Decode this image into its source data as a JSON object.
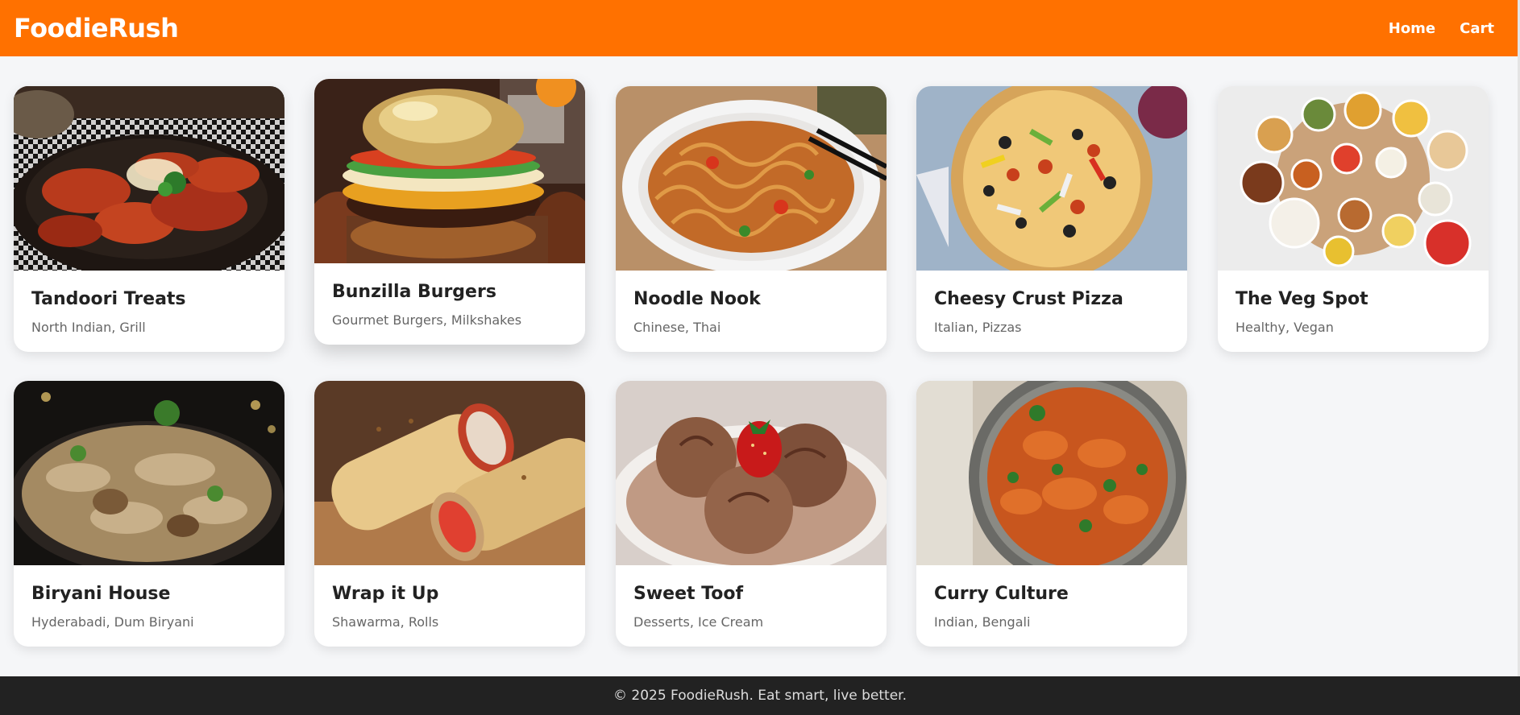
{
  "brand": "FoodieRush",
  "nav": {
    "home": "Home",
    "cart": "Cart"
  },
  "colors": {
    "primary": "#ff7100",
    "footer": "#222222"
  },
  "restaurants": [
    {
      "name": "Tandoori Treats",
      "cuisine": "North Indian, Grill",
      "image": "tandoori-chicken-image"
    },
    {
      "name": "Bunzilla Burgers",
      "cuisine": "Gourmet Burgers, Milkshakes",
      "image": "burger-image"
    },
    {
      "name": "Noodle Nook",
      "cuisine": "Chinese, Thai",
      "image": "noodles-image"
    },
    {
      "name": "Cheesy Crust Pizza",
      "cuisine": "Italian, Pizzas",
      "image": "pizza-image"
    },
    {
      "name": "The Veg Spot",
      "cuisine": "Healthy, Vegan",
      "image": "veg-thali-image"
    },
    {
      "name": "Biryani House",
      "cuisine": "Hyderabadi, Dum Biryani",
      "image": "biryani-image"
    },
    {
      "name": "Wrap it Up",
      "cuisine": "Shawarma, Rolls",
      "image": "wrap-image"
    },
    {
      "name": "Sweet Toof",
      "cuisine": "Desserts, Ice Cream",
      "image": "ice-cream-image"
    },
    {
      "name": "Curry Culture",
      "cuisine": "Indian, Bengali",
      "image": "curry-image"
    }
  ],
  "footer": "© 2025 FoodieRush. Eat smart, live better."
}
